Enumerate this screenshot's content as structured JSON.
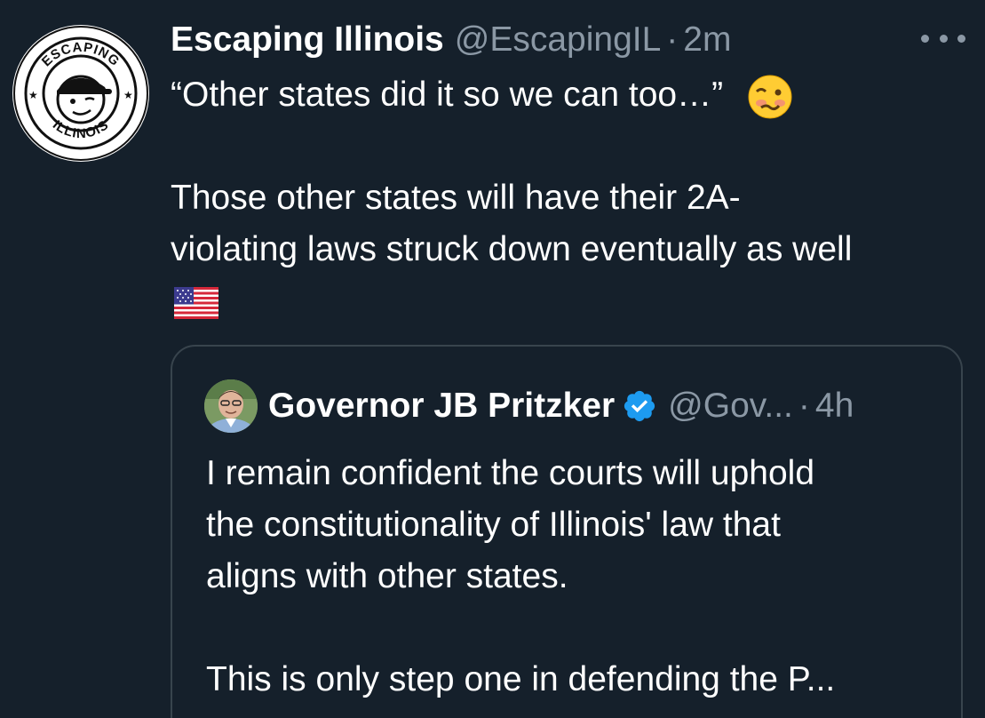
{
  "tweet": {
    "display_name": "Escaping Illinois",
    "handle": "@EscapingIL",
    "separator": "·",
    "time": "2m",
    "lines": [
      "“Other states did it so we can too…”",
      "",
      "Those other states will have their 2A-",
      "violating laws struck down eventually as well"
    ],
    "emojis": [
      "woozy-face",
      "us-flag"
    ],
    "avatar_text_top": "ESCAPING",
    "avatar_text_bottom": "ILLINOIS"
  },
  "quoted_tweet": {
    "display_name": "Governor JB Pritzker",
    "verified": true,
    "handle": "@Gov...",
    "separator": "·",
    "time": "4h",
    "lines": [
      "I remain confident the courts will uphold",
      "the constitutionality of Illinois' law that",
      "aligns with other states.",
      "",
      "This is only step one in defending the P..."
    ]
  },
  "colors": {
    "background": "#15202b",
    "text": "#ffffff",
    "secondary": "#8b98a5",
    "border": "#38444d",
    "verified": "#1d9bf0"
  }
}
